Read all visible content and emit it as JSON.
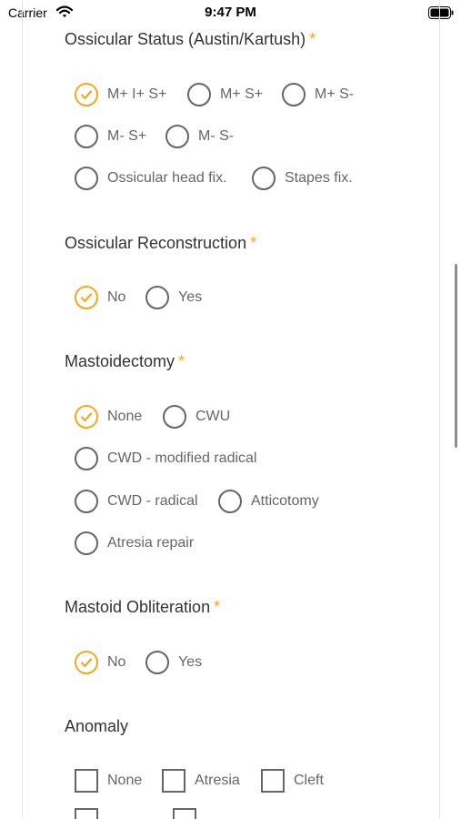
{
  "status_bar": {
    "carrier": "Carrier",
    "time": "9:47 PM"
  },
  "sections": {
    "ossicular_status": {
      "title": "Ossicular Status (Austin/Kartush)",
      "required": "*",
      "options": [
        "M+ I+ S+",
        "M+ S+",
        "M+ S-",
        "M- S+",
        "M- S-",
        "Ossicular head fix.",
        "Stapes fix."
      ],
      "selected": "M+ I+ S+"
    },
    "ossicular_reconstruction": {
      "title": "Ossicular Reconstruction",
      "required": "*",
      "options": [
        "No",
        "Yes"
      ],
      "selected": "No"
    },
    "mastoidectomy": {
      "title": "Mastoidectomy",
      "required": "*",
      "options": [
        "None",
        "CWU",
        "CWD - modified radical",
        "CWD - radical",
        "Atticotomy",
        "Atresia repair"
      ],
      "selected": "None"
    },
    "mastoid_obliteration": {
      "title": "Mastoid Obliteration",
      "required": "*",
      "options": [
        "No",
        "Yes"
      ],
      "selected": "No"
    },
    "anomaly": {
      "title": "Anomaly",
      "options": [
        "None",
        "Atresia",
        "Cleft"
      ]
    }
  },
  "colors": {
    "accent": "#f5a623",
    "text": "#333333",
    "muted": "#666666"
  },
  "icons": {
    "checked_radio": "checkmark-icon",
    "wifi": "wifi-icon",
    "battery": "battery-icon"
  }
}
